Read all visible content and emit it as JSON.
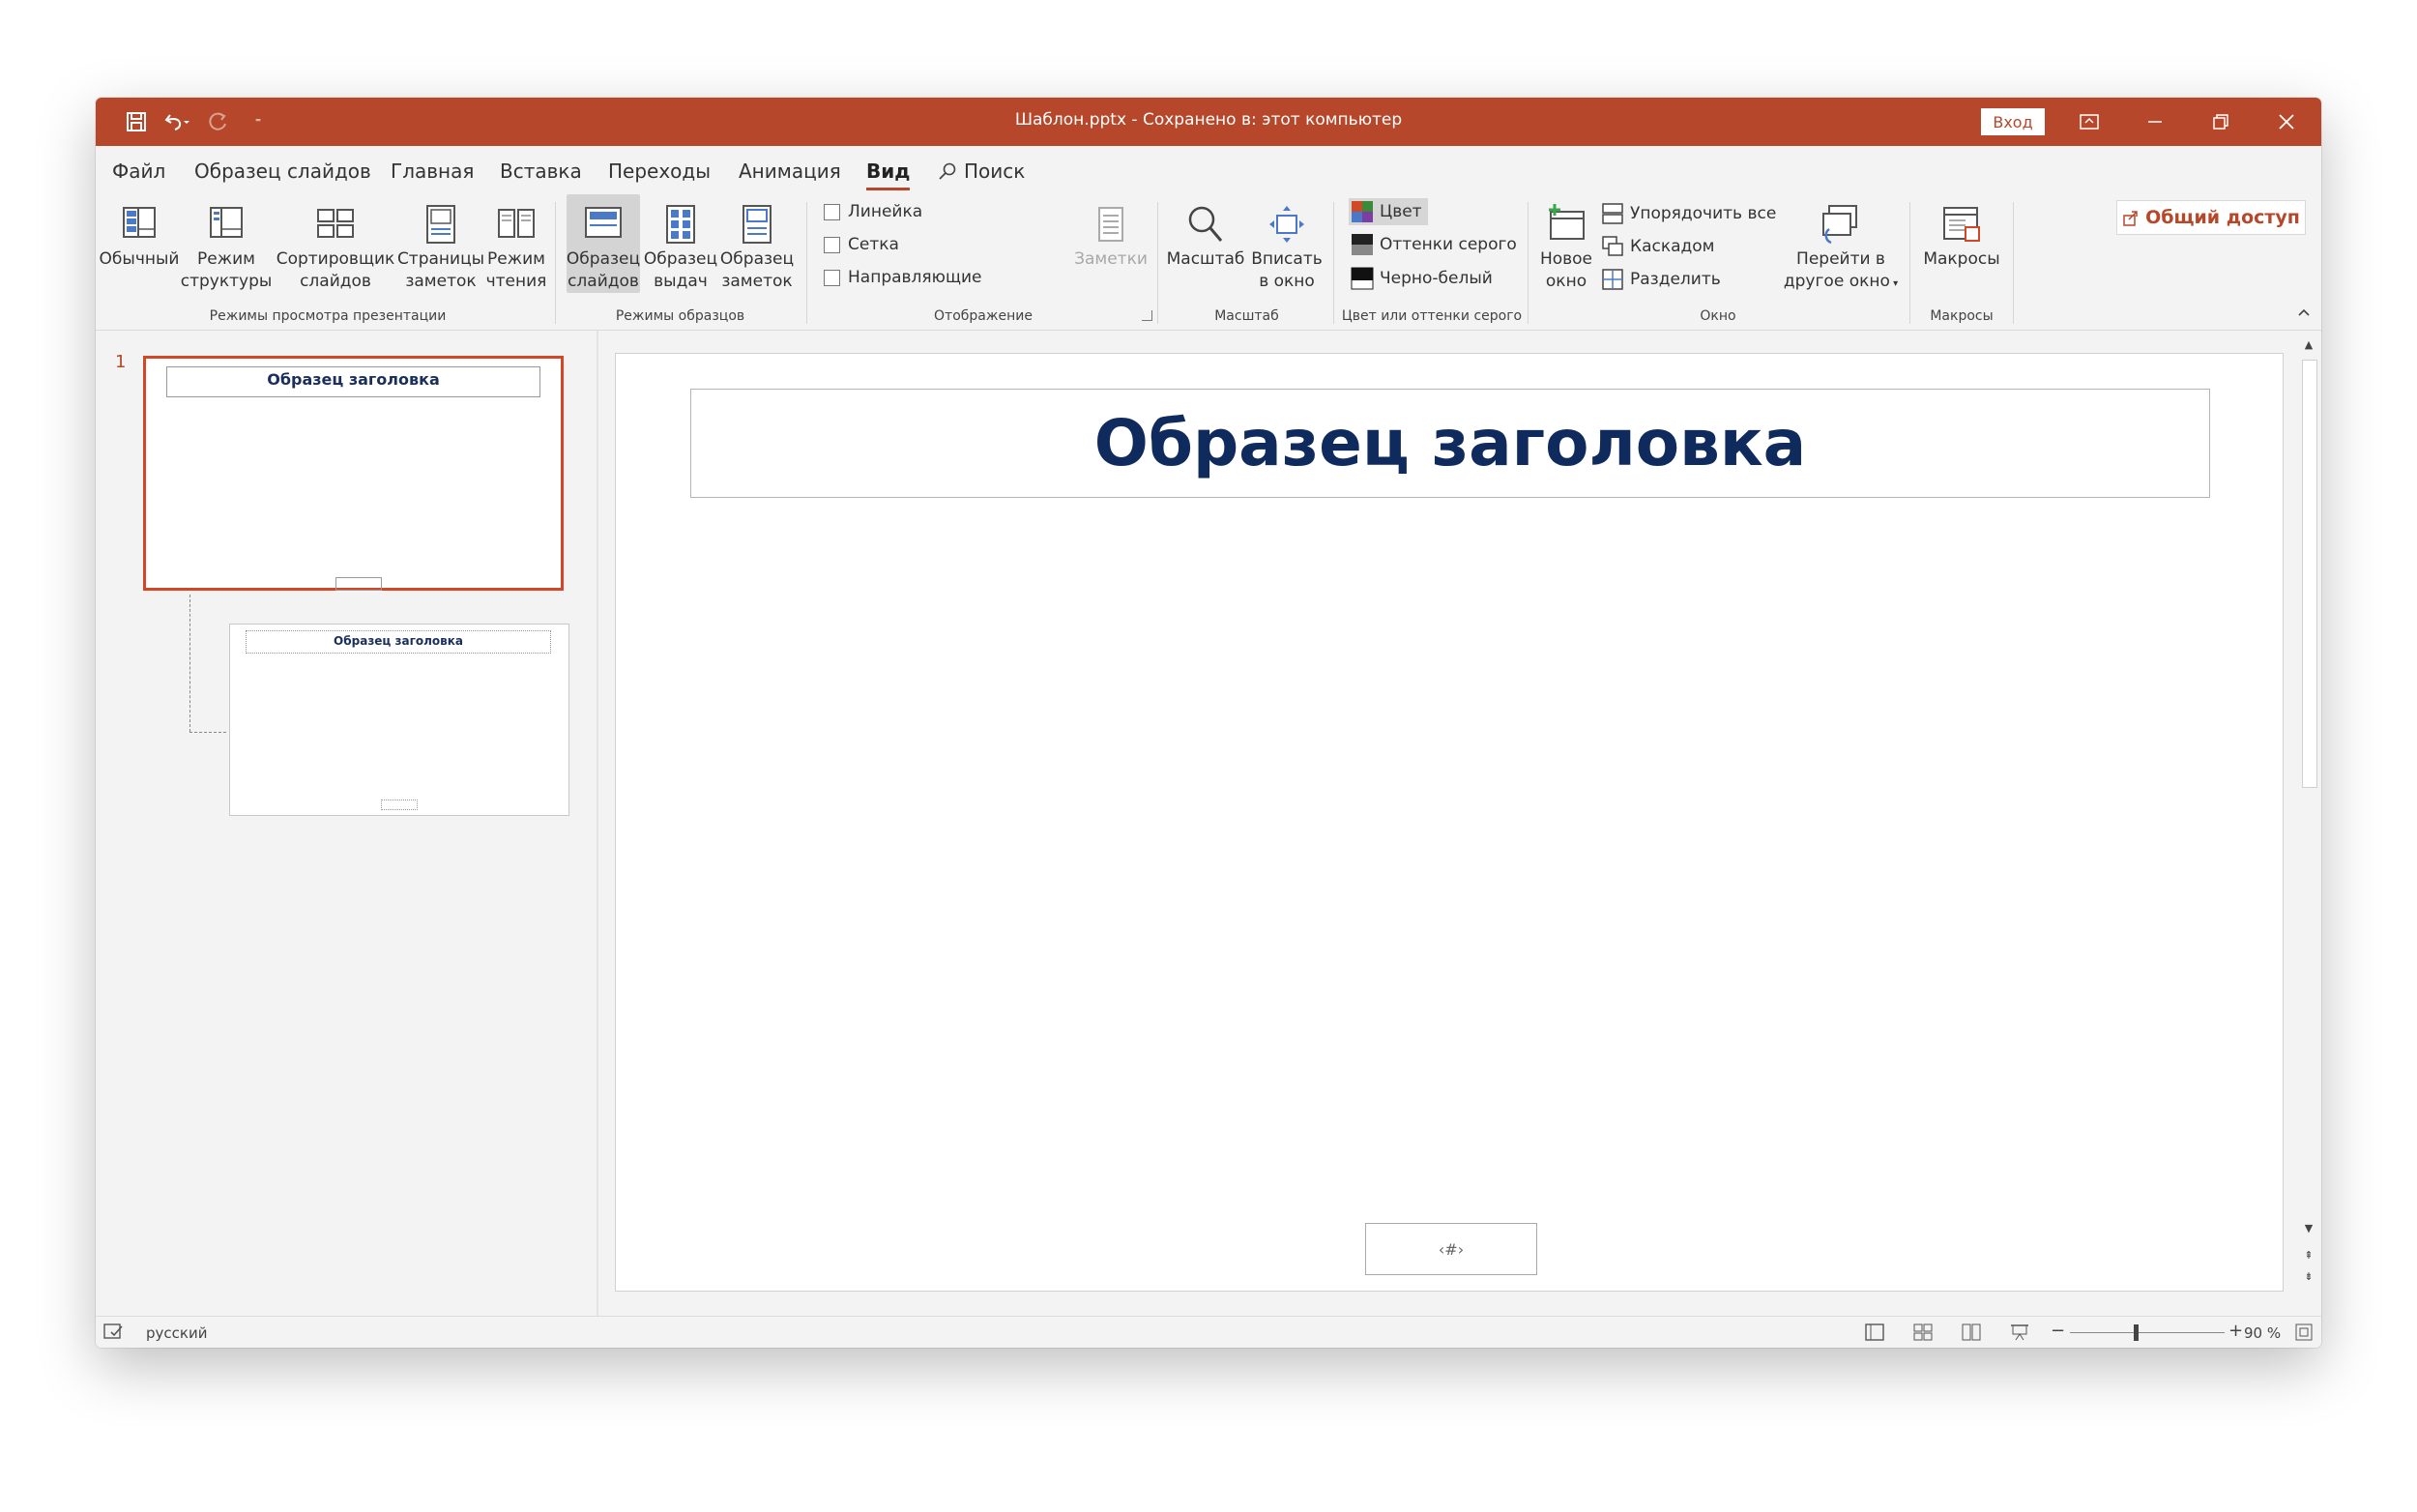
{
  "window": {
    "title": "Шаблон.pptx  -  Сохранено в: этот компьютер",
    "signin_label": "Вход"
  },
  "menu": {
    "tabs": [
      "Файл",
      "Образец слайдов",
      "Главная",
      "Вставка",
      "Переходы",
      "Анимация",
      "Вид"
    ],
    "active_tab": "Вид",
    "search_label": "Поиск",
    "share_label": "Общий доступ"
  },
  "ribbon": {
    "views": {
      "normal": "Обычный",
      "outline": [
        "Режим",
        "структуры"
      ],
      "sorter": [
        "Сортировщик",
        "слайдов"
      ],
      "notes_page": [
        "Страницы",
        "заметок"
      ],
      "reading": [
        "Режим",
        "чтения"
      ],
      "group_label": "Режимы просмотра презентации"
    },
    "masters": {
      "slide_master": [
        "Образец",
        "слайдов"
      ],
      "handout_master": [
        "Образец",
        "выдач"
      ],
      "notes_master": [
        "Образец",
        "заметок"
      ],
      "group_label": "Режимы образцов"
    },
    "show": {
      "ruler": "Линейка",
      "grid": "Сетка",
      "guides": "Направляющие",
      "notes": "Заметки",
      "group_label": "Отображение"
    },
    "zoom": {
      "zoom": "Масштаб",
      "fit": [
        "Вписать",
        "в окно"
      ],
      "group_label": "Масштаб"
    },
    "color": {
      "color": "Цвет",
      "grayscale": "Оттенки серого",
      "bw": "Черно-белый",
      "group_label": "Цвет или оттенки серого"
    },
    "window": {
      "new_window": [
        "Новое",
        "окно"
      ],
      "arrange_all": "Упорядочить все",
      "cascade": "Каскадом",
      "split": "Разделить",
      "switch": [
        "Перейти в",
        "другое окно"
      ],
      "group_label": "Окно"
    },
    "macros": {
      "macros": "Макросы",
      "group_label": "Макросы"
    }
  },
  "thumbnails": {
    "slide_number": "1",
    "master_title": "Образец заголовка",
    "layout_title": "Образец заголовка"
  },
  "slide": {
    "title": "Образец заголовка",
    "number_placeholder": "‹#›"
  },
  "status": {
    "language": "русский",
    "zoom": "90 %"
  },
  "colors": {
    "accent": "#b7472a",
    "title_text": "#0f2a5c"
  }
}
